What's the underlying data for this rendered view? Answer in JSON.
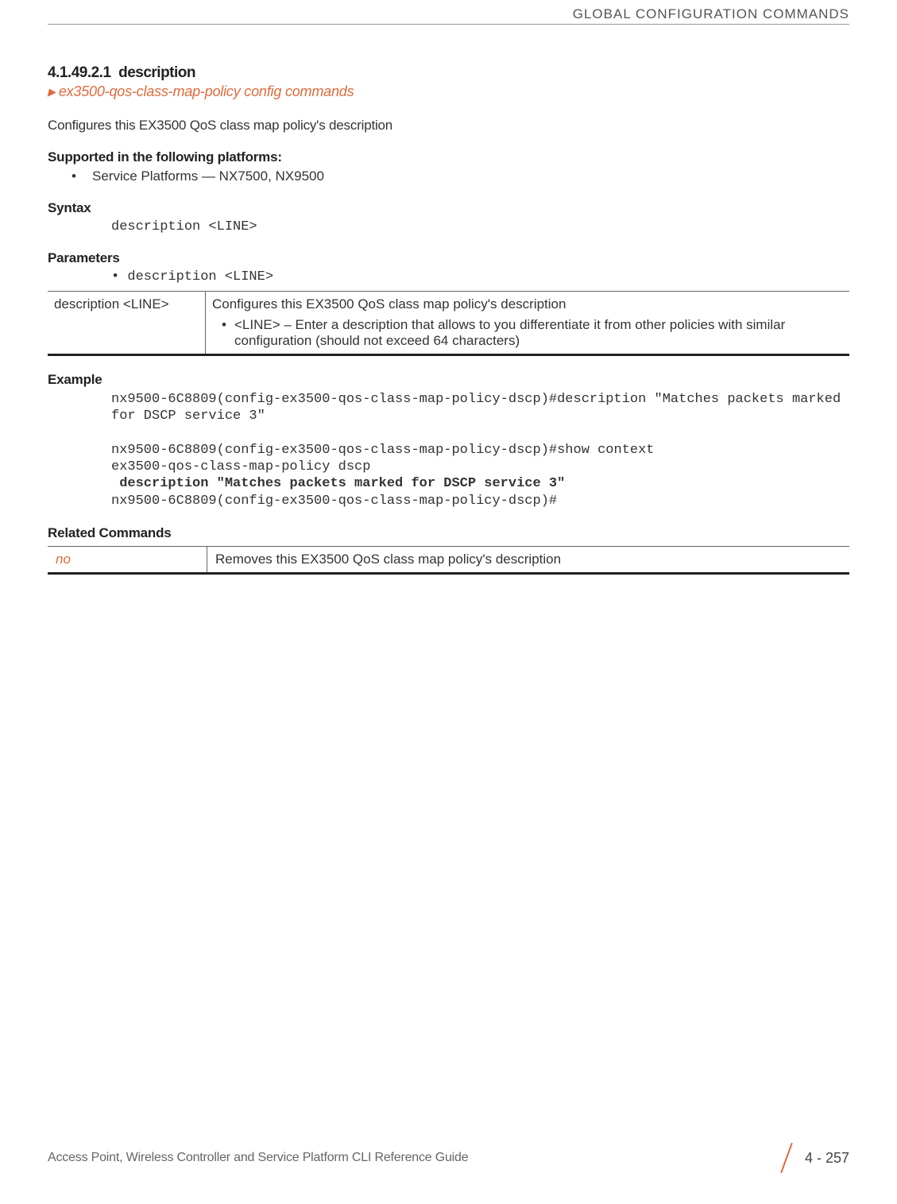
{
  "header": {
    "running_title": "GLOBAL CONFIGURATION COMMANDS"
  },
  "section": {
    "number": "4.1.49.2.1",
    "title": "description",
    "breadcrumb": "ex3500-qos-class-map-policy config commands",
    "intro": "Configures this EX3500 QoS class map policy's description"
  },
  "supported": {
    "label": "Supported in the following platforms:",
    "items": [
      "Service Platforms — NX7500, NX9500"
    ]
  },
  "syntax": {
    "label": "Syntax",
    "text": "description <LINE>"
  },
  "parameters": {
    "label": "Parameters",
    "bullet": "description <LINE>",
    "table": {
      "left": "description <LINE>",
      "right_line1": "Configures this EX3500 QoS class map policy's description",
      "right_bullet": "<LINE> – Enter a description that allows to you differentiate it from other policies with similar configuration (should not exceed 64 characters)"
    }
  },
  "example": {
    "label": "Example",
    "line1": "nx9500-6C8809(config-ex3500-qos-class-map-policy-dscp)#description \"Matches packets marked for DSCP service 3\"",
    "line2": "nx9500-6C8809(config-ex3500-qos-class-map-policy-dscp)#show context",
    "line3": "ex3500-qos-class-map-policy dscp",
    "line4_bold": " description \"Matches packets marked for DSCP service 3\"",
    "line5": "nx9500-6C8809(config-ex3500-qos-class-map-policy-dscp)#"
  },
  "related": {
    "label": "Related Commands",
    "table": {
      "left": "no",
      "right": "Removes this EX3500 QoS class map policy's description"
    }
  },
  "footer": {
    "title": "Access Point, Wireless Controller and Service Platform CLI Reference Guide",
    "page": "4 - 257"
  }
}
